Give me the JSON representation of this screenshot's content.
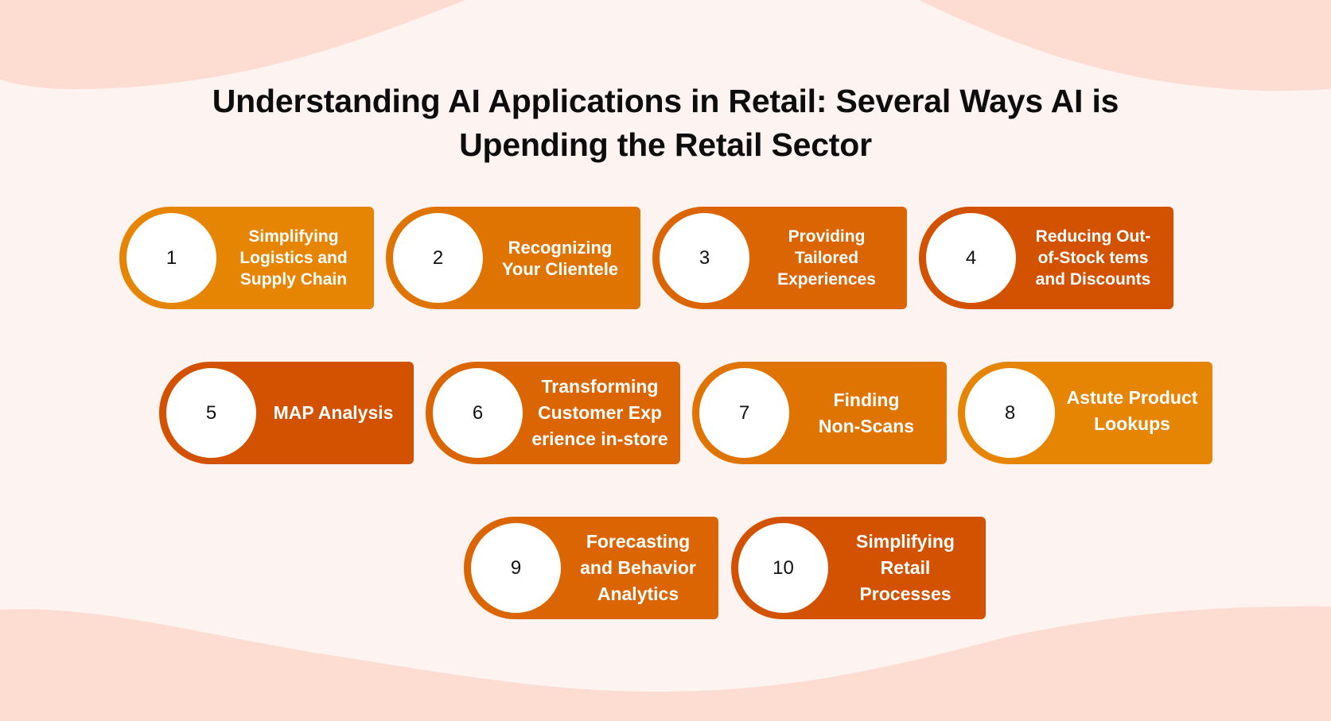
{
  "title": {
    "line1": "Understanding AI Applications in Retail: Several Ways AI is",
    "line2": "Upending the Retail Sector"
  },
  "colors": {
    "background": "#fdf3f0",
    "wave": "#fddcd2",
    "orange_light": "#e68404",
    "orange_mid": "#e07403",
    "orange_dark": "#db6502",
    "orange_deep": "#d25201",
    "text_on_card": "#ffffff",
    "number_text": "#111111"
  },
  "items": [
    {
      "number": "1",
      "lines": [
        "Simplifying",
        "Logistics and",
        "Supply Chain"
      ],
      "color": "#e68404"
    },
    {
      "number": "2",
      "lines": [
        "Recognizing",
        "Your Clientele"
      ],
      "color": "#e07403"
    },
    {
      "number": "3",
      "lines": [
        "Providing",
        "Tailored",
        "Experiences"
      ],
      "color": "#db6502"
    },
    {
      "number": "4",
      "lines": [
        "Reducing Out-",
        "of-Stock tems",
        "and Discounts"
      ],
      "color": "#d25201"
    },
    {
      "number": "5",
      "lines": [
        "MAP Analysis"
      ],
      "color": "#d25201"
    },
    {
      "number": "6",
      "lines": [
        "Transforming",
        "Customer Exp",
        "erience in-store"
      ],
      "color": "#db6502"
    },
    {
      "number": "7",
      "lines": [
        "Finding",
        "Non-Scans"
      ],
      "color": "#e07403"
    },
    {
      "number": "8",
      "lines": [
        "Astute Product",
        "Lookups"
      ],
      "color": "#e68404"
    },
    {
      "number": "9",
      "lines": [
        "Forecasting",
        "and Behavior",
        "Analytics"
      ],
      "color": "#db6502"
    },
    {
      "number": "10",
      "lines": [
        "Simplifying",
        "Retail",
        "Processes"
      ],
      "color": "#d25201"
    }
  ]
}
